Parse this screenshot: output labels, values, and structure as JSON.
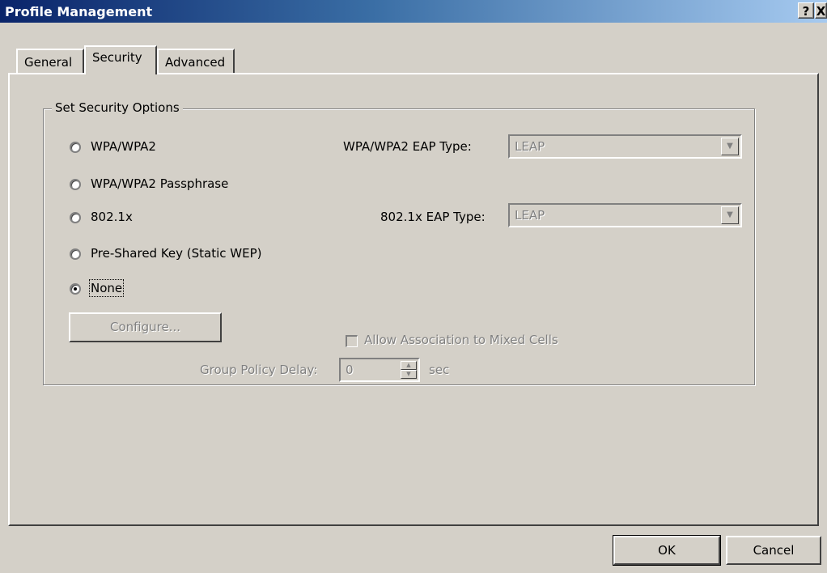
{
  "window": {
    "title": "Profile Management",
    "help_label": "?",
    "close_label": "X"
  },
  "tabs": [
    {
      "label": "General"
    },
    {
      "label": "Security"
    },
    {
      "label": "Advanced"
    }
  ],
  "security": {
    "group_title": "Set Security Options",
    "options": [
      {
        "label": "WPA/WPA2",
        "selected": false
      },
      {
        "label": "WPA/WPA2 Passphrase",
        "selected": false
      },
      {
        "label": "802.1x",
        "selected": false
      },
      {
        "label": "Pre-Shared Key (Static WEP)",
        "selected": false
      },
      {
        "label": "None",
        "selected": true
      }
    ],
    "wpa_eap_label": "WPA/WPA2 EAP Type:",
    "wpa_eap_value": "LEAP",
    "dot1x_eap_label": "802.1x EAP Type:",
    "dot1x_eap_value": "LEAP",
    "configure_label": "Configure...",
    "mixed_cells_label": "Allow Association to Mixed Cells",
    "group_policy_label": "Group Policy Delay:",
    "group_policy_value": "0",
    "group_policy_unit": "sec"
  },
  "footer": {
    "ok_label": "OK",
    "cancel_label": "Cancel"
  },
  "icons": {
    "dropdown": "chevron-down-icon",
    "spinner": "spinner-arrows-icon"
  }
}
